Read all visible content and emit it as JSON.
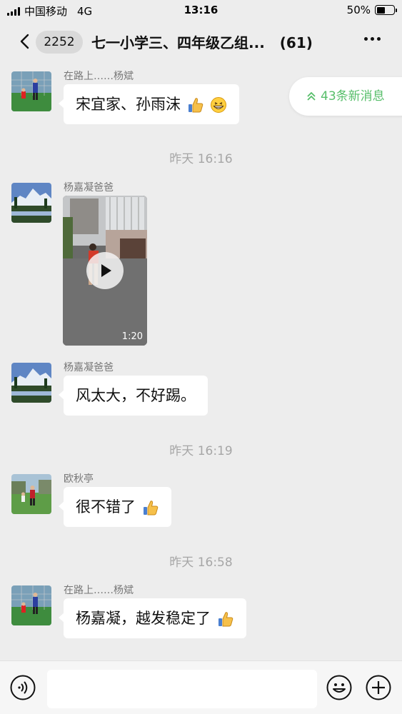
{
  "status_bar": {
    "carrier": "中国移动",
    "network": "4G",
    "time": "13:16",
    "battery": "50%",
    "battery_level": 0.5
  },
  "nav": {
    "unread_count": "2252",
    "title": "七一小学三、四年级乙组...",
    "member_count": "(61)"
  },
  "new_messages": {
    "label": "43条新消息"
  },
  "messages": [
    {
      "sender": "在路上……杨斌",
      "text": "宋宜家、孙雨沫",
      "emojis": [
        "thumbs-up-icon",
        "grin-icon"
      ]
    },
    {
      "time": "昨天 16:16"
    },
    {
      "sender": "杨嘉凝爸爸",
      "type": "video",
      "duration": "1:20"
    },
    {
      "sender": "杨嘉凝爸爸",
      "text": "风太大，不好踢。"
    },
    {
      "time": "昨天 16:19"
    },
    {
      "sender": "欧秋亭",
      "text": "很不错了",
      "emojis": [
        "thumbs-up-icon"
      ]
    },
    {
      "time": "昨天 16:58"
    },
    {
      "sender": "在路上……杨斌",
      "text": "杨嘉凝，越发稳定了",
      "emojis": [
        "thumbs-up-icon"
      ]
    }
  ],
  "input_bar": {
    "placeholder": ""
  },
  "colors": {
    "background": "#ededed",
    "bubble": "#ffffff",
    "accent_green": "#57be6a",
    "timestamp": "#a6a6a6"
  }
}
